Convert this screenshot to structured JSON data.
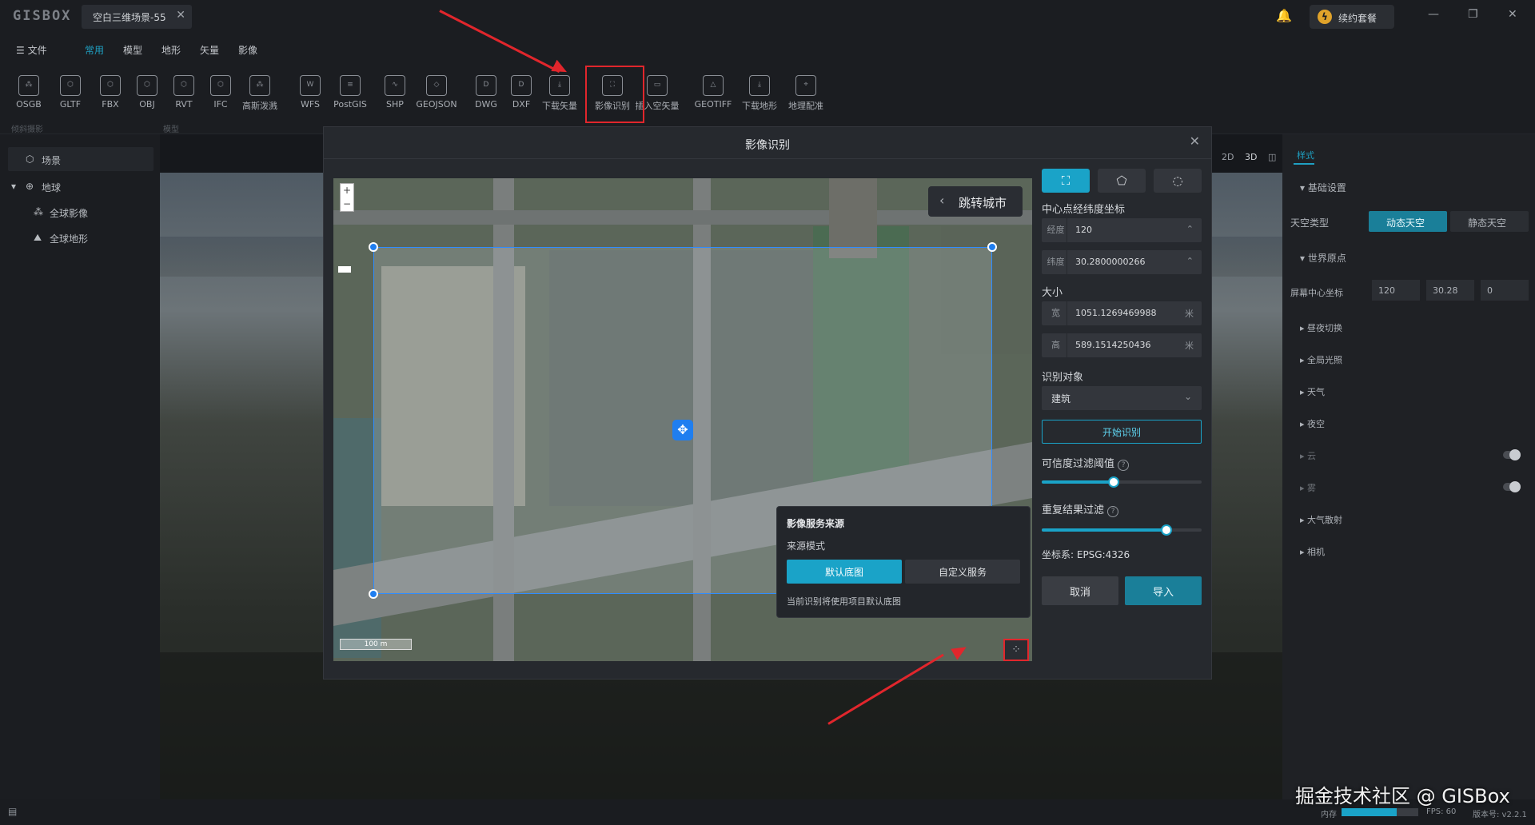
{
  "app": {
    "logo": "GISBOX",
    "tab_title": "空白三维场景-55",
    "renew_label": "续约套餐"
  },
  "menu": [
    "文件",
    "常用",
    "模型",
    "地形",
    "矢量",
    "影像"
  ],
  "toolbar": {
    "tools": [
      {
        "label": "OSGB",
        "icon": "osgb-icon"
      },
      {
        "label": "GLTF",
        "icon": "gltf-icon"
      },
      {
        "label": "FBX",
        "icon": "fbx-icon"
      },
      {
        "label": "OBJ",
        "icon": "obj-icon"
      },
      {
        "label": "RVT",
        "icon": "rvt-icon"
      },
      {
        "label": "IFC",
        "icon": "ifc-icon"
      },
      {
        "label": "高斯泼溅",
        "icon": "gaussian-splat-icon"
      },
      {
        "label": "WFS",
        "icon": "wfs-icon"
      },
      {
        "label": "PostGIS",
        "icon": "database-icon"
      },
      {
        "label": "SHP",
        "icon": "shp-icon"
      },
      {
        "label": "GEOJSON",
        "icon": "geojson-icon"
      },
      {
        "label": "DWG",
        "icon": "dwg-icon"
      },
      {
        "label": "DXF",
        "icon": "dxf-icon"
      },
      {
        "label": "下载矢量",
        "icon": "download-vector-icon"
      },
      {
        "label": "影像识别",
        "icon": "image-recognition-icon"
      },
      {
        "label": "插入空矢量",
        "icon": "insert-empty-vector-icon"
      },
      {
        "label": "GEOTIFF",
        "icon": "geotiff-icon"
      },
      {
        "label": "下载地形",
        "icon": "download-terrain-icon"
      },
      {
        "label": "地理配准",
        "icon": "georeference-icon"
      }
    ],
    "groups": [
      "倾斜摄影",
      "模型"
    ]
  },
  "tree": {
    "scene": "场景",
    "globe": "地球",
    "imagery": "全球影像",
    "terrain": "全球地形"
  },
  "view_modes": [
    "2D",
    "3D",
    "◫"
  ],
  "right_panel": {
    "tab": "样式",
    "basic": "基础设置",
    "sky_type": "天空类型",
    "sky_dynamic": "动态天空",
    "sky_static": "静态天空",
    "world_origin": "世界原点",
    "screen_center": "屏幕中心坐标",
    "origin_values": [
      "120",
      "30.28",
      "0"
    ],
    "sections": [
      "昼夜切换",
      "全局光照",
      "天气",
      "夜空",
      "云",
      "雾",
      "大气散射",
      "相机"
    ]
  },
  "modal": {
    "title": "影像识别",
    "jump_city": "跳转城市",
    "scale": "100 m",
    "center_label": "中心点经纬度坐标",
    "lon_label": "经度",
    "lon_value": "120",
    "lat_label": "纬度",
    "lat_value": "30.2800000266",
    "size_label": "大小",
    "width_label": "宽",
    "width_value": "1051.1269469988",
    "height_label": "高",
    "height_value": "589.1514250436",
    "unit": "米",
    "target_label": "识别对象",
    "target_value": "建筑",
    "start_label": "开始识别",
    "confidence_label": "可信度过滤阈值",
    "confidence": 0.45,
    "dedupe_label": "重复结果过滤",
    "dedupe": 0.78,
    "crs": "坐标系: EPSG:4326",
    "cancel": "取消",
    "import": "导入",
    "source": {
      "title": "影像服务来源",
      "mode": "来源模式",
      "default": "默认底图",
      "custom": "自定义服务",
      "note": "当前识别将使用项目默认底图"
    }
  },
  "status": {
    "memory": "内存",
    "memory_usage": 0.72,
    "fps": "FPS: 60",
    "version": "版本号: v2.2.1"
  },
  "watermark": "掘金技术社区 @ GISBox",
  "colors": {
    "accent": "#1aa3c8",
    "highlight": "#e1262c",
    "selection": "#1f7ef0"
  }
}
